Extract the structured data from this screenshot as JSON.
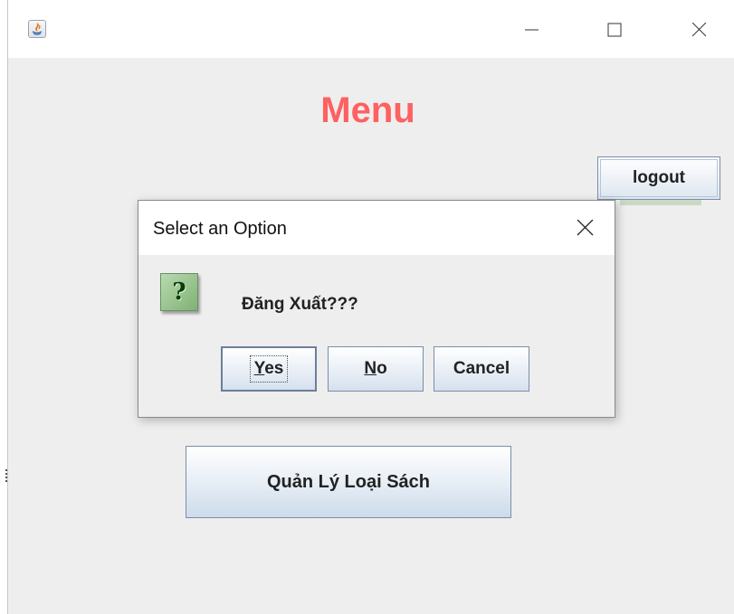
{
  "window": {
    "title": "",
    "controls": {
      "minimize_icon": "minimize-icon",
      "maximize_icon": "maximize-icon",
      "close_icon": "close-icon"
    }
  },
  "main": {
    "title": "Menu",
    "title_color": "#ff6060",
    "logout_label": "logout",
    "manage_categories_label": "Quản Lý Loại Sách"
  },
  "dialog": {
    "title": "Select an Option",
    "message": "Đăng Xuất???",
    "icon": "question-icon",
    "buttons": {
      "yes_first": "Y",
      "yes_rest": "es",
      "no_first": "N",
      "no_rest": "o",
      "cancel": "Cancel"
    }
  }
}
